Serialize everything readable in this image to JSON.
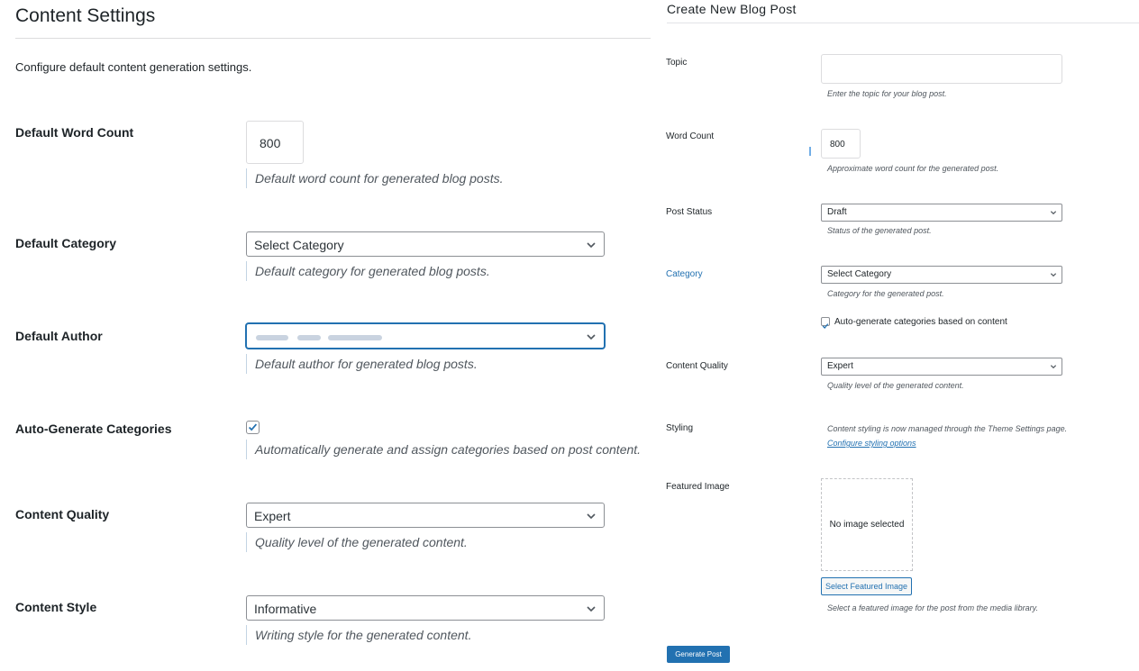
{
  "content_settings": {
    "title": "Content Settings",
    "intro": "Configure default content generation settings.",
    "word_count": {
      "label": "Default Word Count",
      "value": "800",
      "desc": "Default word count for generated blog posts."
    },
    "category": {
      "label": "Default Category",
      "value": "Select Category",
      "desc": "Default category for generated blog posts."
    },
    "author": {
      "label": "Default Author",
      "value": "",
      "desc": "Default author for generated blog posts."
    },
    "auto_categories": {
      "label": "Auto-Generate Categories",
      "checked": true,
      "desc": "Automatically generate and assign categories based on post content."
    },
    "quality": {
      "label": "Content Quality",
      "value": "Expert",
      "desc": "Quality level of the generated content."
    },
    "style": {
      "label": "Content Style",
      "value": "Informative",
      "desc": "Writing style for the generated content."
    }
  },
  "create_post": {
    "title": "Create New Blog Post",
    "topic": {
      "label": "Topic",
      "value": "",
      "desc": "Enter the topic for your blog post."
    },
    "word_count": {
      "label": "Word Count",
      "value": "800",
      "desc": "Approximate word count for the generated post."
    },
    "status": {
      "label": "Post Status",
      "value": "Draft",
      "desc": "Status of the generated post."
    },
    "category": {
      "label": "Category",
      "value": "Select Category",
      "desc": "Category for the generated post."
    },
    "auto_categories": {
      "label": "Auto-generate categories based on content",
      "checked": true
    },
    "quality": {
      "label": "Content Quality",
      "value": "Expert",
      "desc": "Quality level of the generated content."
    },
    "styling": {
      "label": "Styling",
      "desc": "Content styling is now managed through the Theme Settings page.",
      "link": "Configure styling options"
    },
    "featured_image": {
      "label": "Featured Image",
      "placeholder": "No image selected",
      "button": "Select Featured Image",
      "desc": "Select a featured image for the post from the media library."
    },
    "submit": "Generate Post"
  },
  "colors": {
    "accent": "#2271b1",
    "border": "#8c8f94",
    "text": "#1d2327",
    "muted": "#50575e"
  }
}
